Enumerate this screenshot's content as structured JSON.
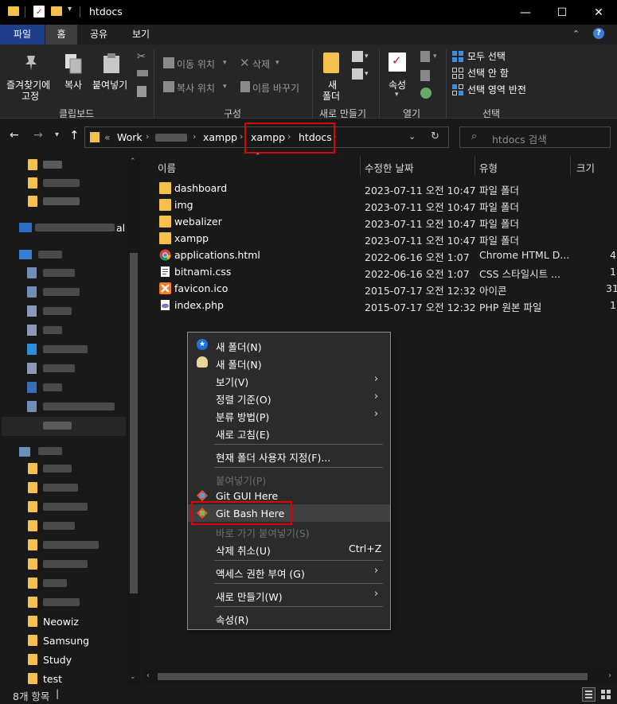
{
  "window": {
    "title": "htdocs",
    "controls": {
      "minimize": "—",
      "maximize": "☐",
      "close": "✕"
    }
  },
  "tabs": [
    {
      "label": "파일"
    },
    {
      "label": "홈"
    },
    {
      "label": "공유"
    },
    {
      "label": "보기"
    }
  ],
  "ribbon": {
    "clipboard": {
      "pin_label_1": "즐겨찾기에",
      "pin_label_2": "고정",
      "copy": "복사",
      "paste": "붙여넣기",
      "group": "클립보드"
    },
    "organize": {
      "move_to": "이동 위치",
      "copy_to": "복사 위치",
      "delete": "삭제",
      "rename": "이름 바꾸기",
      "group": "구성"
    },
    "new": {
      "new_folder_1": "새",
      "new_folder_2": "폴더",
      "group": "새로 만들기"
    },
    "open": {
      "properties": "속성",
      "group": "열기"
    },
    "select": {
      "select_all": "모두 선택",
      "select_none": "선택 안 함",
      "invert": "선택 영역 반전",
      "group": "선택"
    }
  },
  "address": {
    "overflow": "«",
    "crumbs": [
      "Work",
      "xampp",
      "xampp",
      "htdocs"
    ],
    "search_placeholder": "htdocs 검색"
  },
  "nav": {
    "visible_items": [
      "Neowiz",
      "Samsung",
      "Study",
      "test"
    ]
  },
  "columns": {
    "name": "이름",
    "modified": "수정한 날짜",
    "type": "유형",
    "size": "크기"
  },
  "files": [
    {
      "name": "dashboard",
      "modified": "2023-07-11 오전 10:47",
      "type": "파일 폴더",
      "size": "",
      "icon": "folder-icon"
    },
    {
      "name": "img",
      "modified": "2023-07-11 오전 10:47",
      "type": "파일 폴더",
      "size": "",
      "icon": "folder-icon"
    },
    {
      "name": "webalizer",
      "modified": "2023-07-11 오전 10:47",
      "type": "파일 폴더",
      "size": "",
      "icon": "folder-icon"
    },
    {
      "name": "xampp",
      "modified": "2023-07-11 오전 10:47",
      "type": "파일 폴더",
      "size": "",
      "icon": "folder-icon"
    },
    {
      "name": "applications.html",
      "modified": "2022-06-16 오전 1:07",
      "type": "Chrome HTML D...",
      "size": "4",
      "icon": "chrome-icon"
    },
    {
      "name": "bitnami.css",
      "modified": "2022-06-16 오전 1:07",
      "type": "CSS 스타일시트 ...",
      "size": "1",
      "icon": "css-file-icon"
    },
    {
      "name": "favicon.ico",
      "modified": "2015-07-17 오전 12:32",
      "type": "아이콘",
      "size": "31",
      "icon": "xampp-icon"
    },
    {
      "name": "index.php",
      "modified": "2015-07-17 오전 12:32",
      "type": "PHP 원본 파일",
      "size": "1",
      "icon": "php-file-icon"
    }
  ],
  "context_menu": {
    "new_folder_a": "새 폴더(N)",
    "new_folder_b": "새 폴더(N)",
    "view": "보기(V)",
    "sort": "정렬 기준(O)",
    "group_by": "분류 방법(P)",
    "refresh": "새로 고침(E)",
    "customize": "현재 폴더 사용자 지정(F)...",
    "paste": "붙여넣기(P)",
    "git_gui": "Git GUI Here",
    "git_bash": "Git Bash Here",
    "paste_shortcut": "바로 가기 붙여넣기(S)",
    "undo": "삭제 취소(U)",
    "undo_shortcut": "Ctrl+Z",
    "access": "액세스 권한 부여 (G)",
    "new": "새로 만들기(W)",
    "properties": "속성(R)"
  },
  "status": {
    "count": "8개 항목",
    "sep": "|"
  },
  "colors": {
    "highlight": "#e10000",
    "folder": "#f4c04e",
    "tab_active": "#3e3e3e",
    "file_tab": "#1e3e8a"
  }
}
